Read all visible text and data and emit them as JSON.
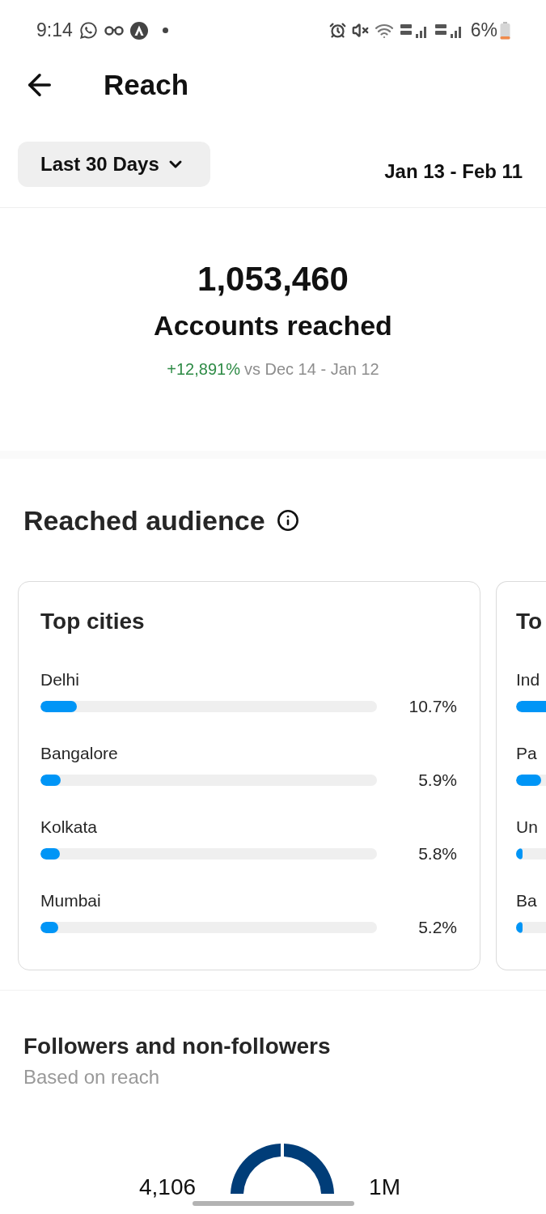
{
  "status_bar": {
    "time": "9:14",
    "battery": "6%"
  },
  "header": {
    "title": "Reach"
  },
  "filter": {
    "period": "Last 30 Days",
    "date_range": "Jan 13 - Feb 11"
  },
  "summary": {
    "value": "1,053,460",
    "label": "Accounts reached",
    "change": "+12,891%",
    "comparison": "vs Dec 14 - Jan 12"
  },
  "reached_audience": {
    "title": "Reached audience",
    "cards": [
      {
        "title": "Top cities",
        "rows": [
          {
            "label": "Delhi",
            "level": 0.107,
            "reading": "10.7%"
          },
          {
            "label": "Bangalore",
            "level": 0.059,
            "reading": "5.9%"
          },
          {
            "label": "Kolkata",
            "level": 0.058,
            "reading": "5.8%"
          },
          {
            "label": "Mumbai",
            "level": 0.052,
            "reading": "5.2%"
          }
        ]
      },
      {
        "title": "To",
        "rows": [
          {
            "label": "Ind",
            "level": 1
          },
          {
            "label": "Pa",
            "level": 0.84
          },
          {
            "label": "Un",
            "level": 0.22
          },
          {
            "label": "Ba",
            "level": 0.22
          }
        ]
      }
    ]
  },
  "followers": {
    "title": "Followers and non-followers",
    "subtitle": "Based on reach",
    "followers_count": "4,106",
    "non_followers_count": "1M"
  }
}
